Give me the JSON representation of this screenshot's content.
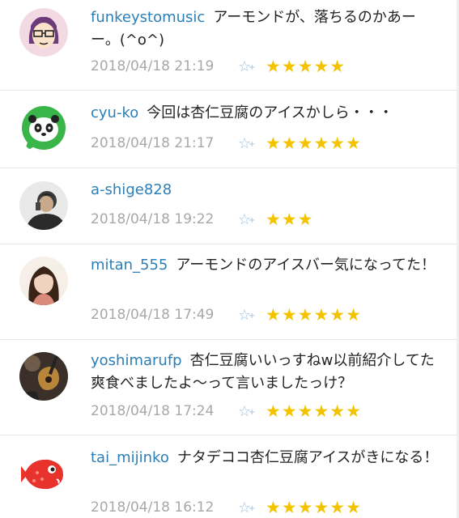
{
  "comments": [
    {
      "user": "funkeystomusic",
      "message": "アーモンドが、落ちるのかあーー。(^o^)",
      "date": "2018/04/18 21:19",
      "star_add_icon": "star-add-icon",
      "stars": "★★★★★",
      "star_count": 5
    },
    {
      "user": "cyu-ko",
      "message": "今回は杏仁豆腐のアイスかしら・・・",
      "date": "2018/04/18 21:17",
      "star_add_icon": "star-add-icon",
      "stars": "★★★★★★",
      "star_count": 6
    },
    {
      "user": "a-shige828",
      "message": "",
      "date": "2018/04/18 19:22",
      "star_add_icon": "star-add-icon",
      "stars": "★★★",
      "star_count": 3
    },
    {
      "user": "mitan_555",
      "message": "アーモンドのアイスバー気になってた！",
      "date": "2018/04/18 17:49",
      "star_add_icon": "star-add-icon",
      "stars": "★★★★★★",
      "star_count": 6
    },
    {
      "user": "yoshimarufp",
      "message": "杏仁豆腐いいっすねw以前紹介してた爽食べましたよ～って言いましたっけ？",
      "date": "2018/04/18 17:24",
      "star_add_icon": "star-add-icon",
      "stars": "★★★★★★",
      "star_count": 6
    },
    {
      "user": "tai_mijinko",
      "message": "ナタデココ杏仁豆腐アイスがきになる！",
      "date": "2018/04/18 16:12",
      "star_add_icon": "star-add-icon",
      "stars": "★★★★★★",
      "star_count": 6
    }
  ],
  "colors": {
    "username": "#2b7fb6",
    "date": "#a8a8a8",
    "star": "#f4c300",
    "star_add": "#9cc0df"
  }
}
